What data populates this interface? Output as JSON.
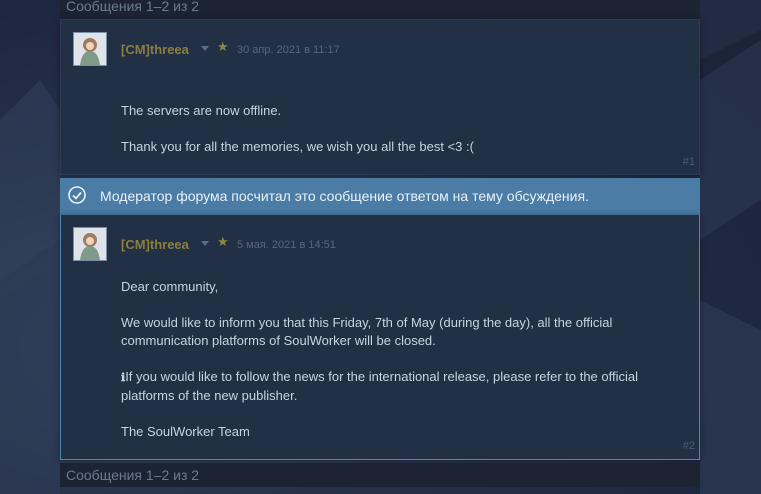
{
  "pagination": {
    "top": "Сообщения 1–2 из 2",
    "bottom": "Сообщения 1–2 из 2"
  },
  "posts": [
    {
      "author": "[CM]threea",
      "date": "30 апр. 2021 в 11:17",
      "paragraphs": [
        "The servers are now offline.",
        "Thank you for all the memories, we wish you all the best <3 :("
      ],
      "number": "#1"
    },
    {
      "author": "[CM]threea",
      "date": "5 мая. 2021 в 14:51",
      "paragraphs": [
        "Dear community,",
        "We would like to inform you that this Friday, 7th of May (during the day), all the official",
        "communication platforms of SoulWorker will be closed.",
        "If you would like to follow the news for the international release, please refer to the official",
        "platforms of the new publisher.",
        "The SoulWorker Team"
      ],
      "info_glyph": "ℹ",
      "number": "#2"
    }
  ],
  "answer_banner": "Модератор форума посчитал это сообщение ответом на тему обсуждения.",
  "colors": {
    "author": "#8a7f3e",
    "banner": "#4a7ca6",
    "post_bg": "#223046"
  }
}
